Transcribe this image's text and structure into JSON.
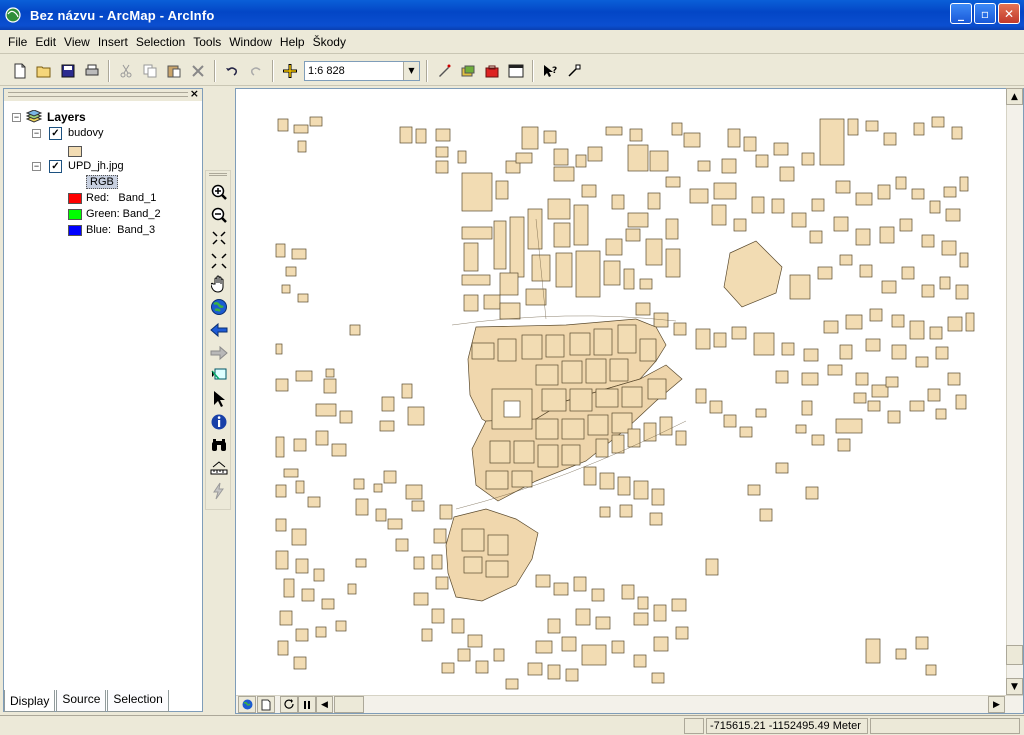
{
  "window": {
    "title": "Bez názvu - ArcMap - ArcInfo",
    "minimize": "_",
    "maximize": "▫",
    "close": "✕"
  },
  "menu": [
    "File",
    "Edit",
    "View",
    "Insert",
    "Selection",
    "Tools",
    "Window",
    "Help",
    "Škody"
  ],
  "toolbar": {
    "scale": "1:6 828"
  },
  "toc": {
    "root_label": "Layers",
    "layers": [
      {
        "name": "budovy",
        "checked": true,
        "swatch_color": "#f2dcb3"
      },
      {
        "name": "UPD_jh.jpg",
        "checked": true
      }
    ],
    "rgb_label": "RGB",
    "bands": [
      {
        "label": "Red:   Band_1",
        "color": "#ff0000"
      },
      {
        "label": "Green: Band_2",
        "color": "#00ff00"
      },
      {
        "label": "Blue:  Band_3",
        "color": "#0000ff"
      }
    ],
    "tabs": [
      "Display",
      "Source",
      "Selection"
    ],
    "active_tab": "Display"
  },
  "status": {
    "coordinates": "-715615.21  -1152495.49 Meter"
  },
  "colors": {
    "building_fill": "#f2dcb3",
    "building_stroke": "#5a4a2e",
    "titlebar": "#0a54d4"
  }
}
